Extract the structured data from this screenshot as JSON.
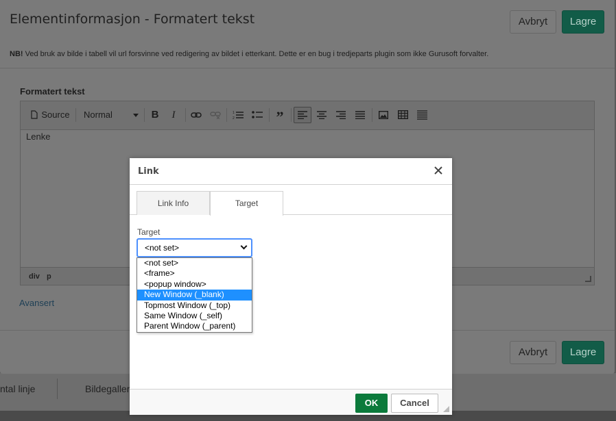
{
  "background": {
    "tabs": [
      "ntal linje",
      "Bildegalleri"
    ]
  },
  "modal": {
    "title": "Elementinformasjon - Formatert tekst",
    "cancel_label": "Avbryt",
    "save_label": "Lagre",
    "note_bold": "NB!",
    "note_text": " Ved bruk av bilde i tabell vil url forsvinne ved redigering av bildet i etterkant. Dette er en bug i tredjeparts plugin som ikke Gurusoft forvalter.",
    "field_label": "Formatert tekst",
    "advanced_link": "Avansert"
  },
  "editor": {
    "source_label": "Source",
    "format_label": "Normal",
    "content": "Lenke",
    "path": [
      "div",
      "p"
    ]
  },
  "dialog": {
    "title": "Link",
    "tabs": [
      "Link Info",
      "Target"
    ],
    "active_tab": "Target",
    "target_label": "Target",
    "target_value": "<not set>",
    "options": [
      "<not set>",
      "<frame>",
      "<popup window>",
      "New Window (_blank)",
      "Topmost Window (_top)",
      "Same Window (_self)",
      "Parent Window (_parent)"
    ],
    "highlighted_option": "New Window (_blank)",
    "ok_label": "OK",
    "cancel_label": "Cancel"
  },
  "colors": {
    "primary_green": "#0b7a3b",
    "highlight_blue": "#1e90ff"
  }
}
